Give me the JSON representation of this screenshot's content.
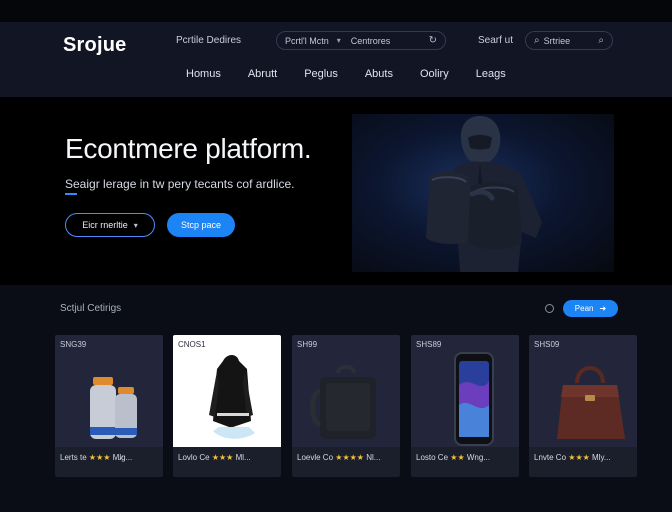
{
  "header": {
    "brand": "Srojue",
    "top_link": "Pcrtile Dedires",
    "filter": {
      "left": "Pcrtl'l Mctn",
      "right": "Centrores"
    },
    "search_label": "Searf ut",
    "search_placeholder": "Srtriee"
  },
  "nav": [
    "Homus",
    "Abrutt",
    "Peglus",
    "Abuts",
    "Ooliry",
    "Leags"
  ],
  "hero": {
    "title": "Econtmere platform.",
    "subtitle": "Seaigr lerage in tw pery tecants cof ardlice.",
    "button_outline": "Eicr rnerltie",
    "button_primary": "Stcp pace"
  },
  "section": {
    "title": "Sctjul Cetirigs",
    "view_button": "Pean"
  },
  "products": [
    {
      "price": "SNG39",
      "name": "Lerts te",
      "stars": "★★★",
      "suffix": "Ml̷g...",
      "image": "bottles"
    },
    {
      "price": "CNOS1",
      "name": "Lovlo Ce",
      "stars": "★★★",
      "suffix": "Ml...",
      "image": "jacket"
    },
    {
      "price": "SH99",
      "name": "Loevle Co",
      "stars": "★★★★",
      "suffix": "Nl...",
      "image": "backpack"
    },
    {
      "price": "SHS89",
      "name": "Losto Ce",
      "stars": "★★",
      "suffix": "Wng...",
      "image": "phone"
    },
    {
      "price": "SHS09",
      "name": "Lnvte Co",
      "stars": "★★★",
      "suffix": "Mly...",
      "image": "handbag"
    }
  ],
  "colors": {
    "accent": "#1d84f5",
    "background": "#0b0d16",
    "header": "#121523",
    "star": "#f2c331"
  }
}
